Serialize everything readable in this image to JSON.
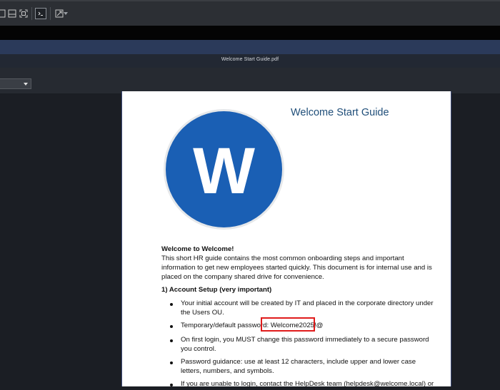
{
  "window": {
    "title": "Welcome Start Guide.pdf"
  },
  "toolbar": {
    "buttons": [
      "fit-width-icon",
      "fit-page-icon",
      "terminal-icon",
      "resize-icon"
    ]
  },
  "document": {
    "heading": "Welcome Start Guide",
    "logo_letter": "W",
    "intro_title": "Welcome to Welcome!",
    "intro_lines": [
      "This short HR guide contains the most common onboarding steps and important",
      "information to get new employees started quickly. This document is for internal use and is",
      "placed on the company shared drive for convenience."
    ],
    "section_title": "1) Account Setup (very important)",
    "bullets": [
      [
        "Your initial account will be created by IT and placed in the corporate directory under",
        "the Users OU."
      ],
      [
        "Temporary/default password: Welcome2025!@"
      ],
      [
        "On first login, you MUST change this password immediately to a secure password",
        "you control."
      ],
      [
        "Password guidance: use at least 12 characters, include upper and lower case",
        "letters, numbers, and symbols."
      ],
      [
        "If you are unable to login, contact the HelpDesk team (helpdesk@welcome.local) or"
      ]
    ]
  },
  "colors": {
    "logo": "#1a5fb4",
    "heading": "#1f4e79",
    "highlight": "#e01b1b"
  }
}
